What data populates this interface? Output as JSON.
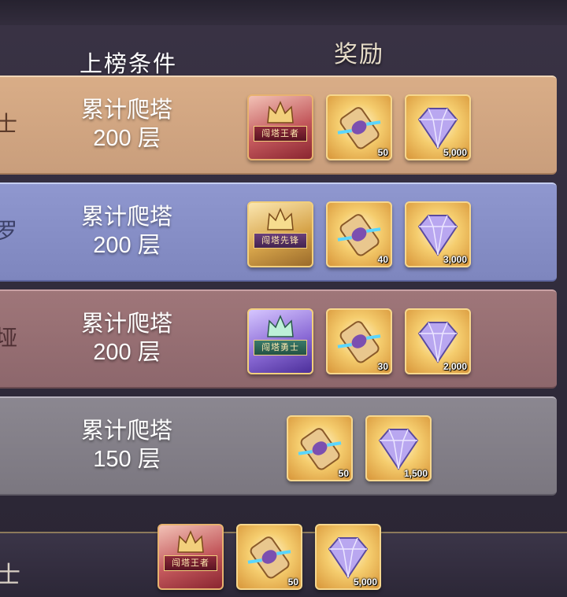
{
  "header": {
    "condition_label": "上榜条件",
    "reward_label": "奖励"
  },
  "rows": [
    {
      "rank_fragment": "士",
      "condition_line1": "累计爬塔",
      "condition_line2": "200 层",
      "rewards": [
        {
          "type": "title",
          "variant": "red",
          "text": "闯塔王者"
        },
        {
          "type": "scroll",
          "qty": "50"
        },
        {
          "type": "gem",
          "qty": "5,000"
        }
      ]
    },
    {
      "rank_fragment": "罗",
      "condition_line1": "累计爬塔",
      "condition_line2": "200 层",
      "rewards": [
        {
          "type": "title",
          "variant": "gold",
          "text": "闯塔先锋"
        },
        {
          "type": "scroll",
          "qty": "40"
        },
        {
          "type": "gem",
          "qty": "3,000"
        }
      ]
    },
    {
      "rank_fragment": "垭",
      "condition_line1": "累计爬塔",
      "condition_line2": "200 层",
      "rewards": [
        {
          "type": "title",
          "variant": "purple",
          "text": "闯塔勇士"
        },
        {
          "type": "scroll",
          "qty": "30"
        },
        {
          "type": "gem",
          "qty": "2,000"
        }
      ]
    },
    {
      "rank_fragment": "",
      "condition_line1": "累计爬塔",
      "condition_line2": "150 层",
      "rewards": [
        {
          "type": "scroll",
          "qty": "50"
        },
        {
          "type": "gem",
          "qty": "1,500"
        }
      ]
    }
  ],
  "footer": {
    "rank_fragment": "士",
    "rewards": [
      {
        "type": "title",
        "variant": "red",
        "text": "闯塔王者"
      },
      {
        "type": "scroll",
        "qty": "50"
      },
      {
        "type": "gem",
        "qty": "5,000"
      }
    ]
  }
}
